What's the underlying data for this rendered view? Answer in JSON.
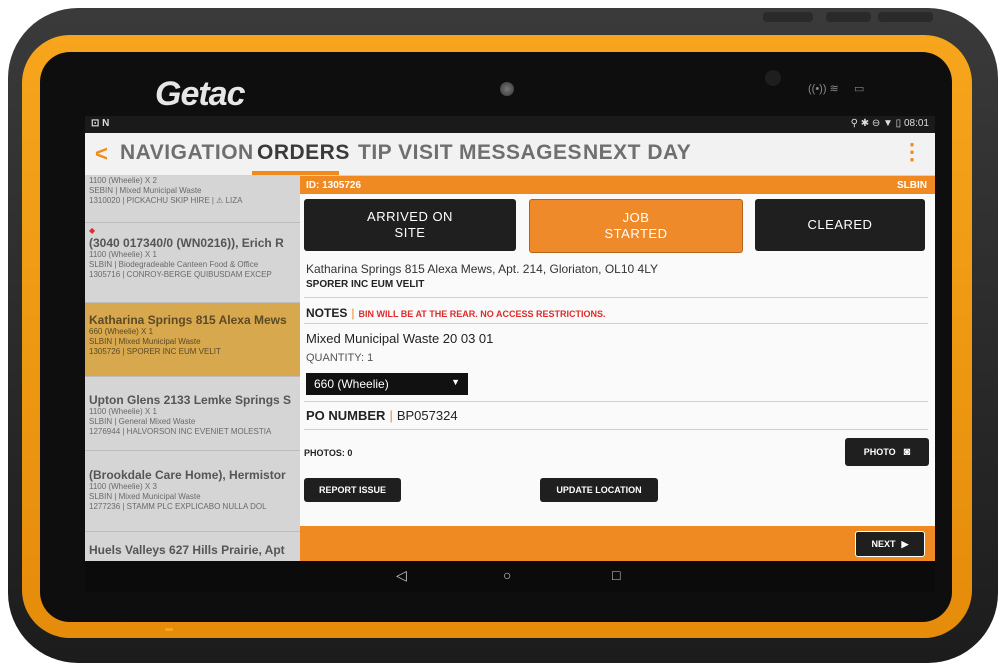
{
  "device": {
    "brand": "Getac"
  },
  "statusbar": {
    "left": "⊡ N",
    "right": "⚲ ✱ ⊖ ▼ ▯ 08:01"
  },
  "tabs": {
    "back": "<",
    "items": [
      {
        "label": "NAVIGATION"
      },
      {
        "label": "ORDERS"
      },
      {
        "label": "TIP VISIT"
      },
      {
        "label": "MESSAGES"
      },
      {
        "label": "NEXT DAY"
      }
    ],
    "menu": "⋮"
  },
  "list": {
    "items": [
      {
        "title": "",
        "lines": [
          "1100 (Wheelie) X 2",
          "SEBIN | Mixed Municipal Waste",
          "1310020 | PICKACHU SKIP HIRE | ⚠ LIZA"
        ]
      },
      {
        "title": "(3040 017340/0 (WN0216)), Erich R",
        "lines": [
          "1100 (Wheelie) X 1",
          "SLBIN | Biodegradeable Canteen Food & Office",
          "1305716 | CONROY-BERGE QUIBUSDAM EXCEP"
        ]
      },
      {
        "title": "Katharina Springs 815 Alexa Mews",
        "lines": [
          "660 (Wheelie) X 1",
          "SLBIN | Mixed Municipal Waste",
          "1305726 | SPORER INC EUM VELIT"
        ]
      },
      {
        "title": "Upton Glens 2133 Lemke Springs S",
        "lines": [
          "1100 (Wheelie) X 1",
          "SLBIN | General Mixed Waste",
          "1276944 | HALVORSON INC EVENIET MOLESTIA"
        ]
      },
      {
        "title": "(Brookdale Care Home), Hermistor",
        "lines": [
          "1100 (Wheelie) X 3",
          "SLBIN | Mixed Municipal Waste",
          "1277236 | STAMM PLC EXPLICABO NULLA DOL"
        ]
      },
      {
        "title": "Huels Valleys 627 Hills Prairie, Apt",
        "lines": []
      }
    ]
  },
  "panel": {
    "id": "ID: 1305726",
    "type": "SLBIN",
    "buttons": {
      "arrived": "ARRIVED ON\nSITE",
      "started": "JOB\nSTARTED",
      "cleared": "CLEARED"
    },
    "address": "Katharina Springs 815 Alexa Mews, Apt. 214, Gloriaton, OL10 4LY",
    "company": "SPORER INC EUM VELIT",
    "notes_label": "NOTES",
    "notes_text": "BIN WILL BE AT THE REAR. NO ACCESS RESTRICTIONS.",
    "waste": "Mixed Municipal Waste 20 03 01",
    "quantity": "QUANTITY: 1",
    "bin_select": "660 (Wheelie)",
    "po_label": "PO NUMBER",
    "po_value": "BP057324",
    "photos": "PHOTOS: 0",
    "photo_button": "PHOTO",
    "report_issue": "REPORT ISSUE",
    "update_location": "UPDATE LOCATION",
    "next": "NEXT"
  },
  "colors": {
    "accent": "#ef8a22",
    "bezel": "#f6a51c",
    "dark_button": "#1f1f1f",
    "alert_red": "#e02b2b"
  }
}
